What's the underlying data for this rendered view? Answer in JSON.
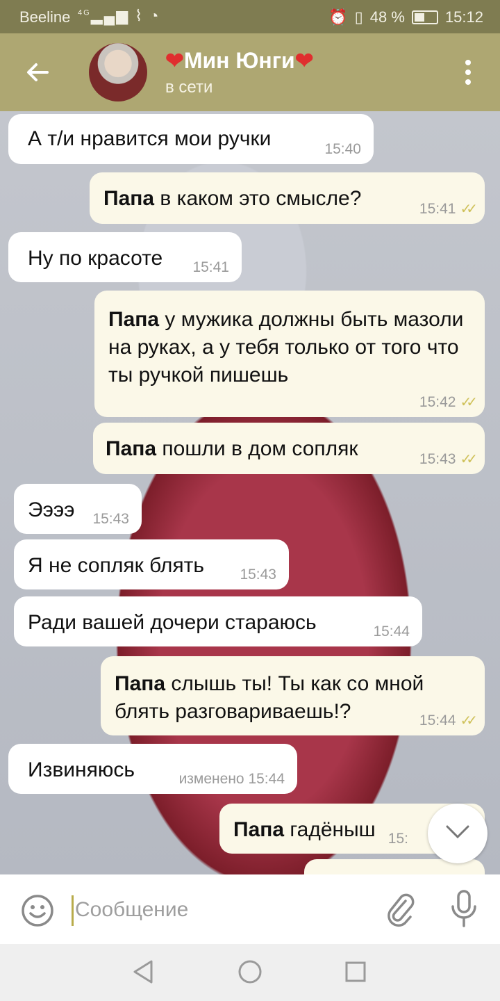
{
  "status_bar": {
    "carrier": "Beeline",
    "network": "4G",
    "battery_text": "48 %",
    "time": "15:12"
  },
  "header": {
    "heart_left": "❤",
    "name": "Мин Юнги",
    "heart_right": "❤",
    "status": "в сети"
  },
  "messages": [
    {
      "dir": "in",
      "text": "А т/и нравится мои ручки",
      "time": "15:40"
    },
    {
      "dir": "out",
      "sender": "Папа",
      "text": " в каком это смысле?",
      "time": "15:41",
      "read": true
    },
    {
      "dir": "in",
      "text": "Ну по красоте",
      "time": "15:41"
    },
    {
      "dir": "out",
      "sender": "Папа",
      "text": " у мужика должны быть мазоли на руках, а у тебя только от того что ты ручкой пишешь",
      "time": "15:42",
      "read": true
    },
    {
      "dir": "out",
      "sender": "Папа",
      "text": " пошли в дом сопляк",
      "time": "15:43",
      "read": true
    },
    {
      "dir": "in",
      "text": "Ээээ",
      "time": "15:43"
    },
    {
      "dir": "in",
      "text": "Я не сопляк блять",
      "time": "15:43"
    },
    {
      "dir": "in",
      "text": "Ради вашей дочери стараюсь",
      "time": "15:44"
    },
    {
      "dir": "out",
      "sender": "Папа",
      "text": " слышь ты! Ты как со мной блять разговариваешь!?",
      "time": "15:44",
      "read": true
    },
    {
      "dir": "in",
      "text": "Извиняюсь",
      "time": "изменено 15:44"
    },
    {
      "dir": "out",
      "sender": "Папа",
      "text": " гадёныш",
      "time": "15:",
      "read": false
    }
  ],
  "input": {
    "placeholder": "Сообщение"
  },
  "icons": {
    "back": "arrow-left-icon",
    "menu": "more-vert-icon",
    "emoji": "smile-icon",
    "attach": "paperclip-icon",
    "mic": "mic-icon",
    "scroll": "chevron-down-icon"
  },
  "colors": {
    "header": "#aea772",
    "status_bar": "#7f7c51",
    "outgoing_bubble": "#fbf8e8",
    "incoming_bubble": "#ffffff",
    "read_check": "#cfc15a"
  }
}
